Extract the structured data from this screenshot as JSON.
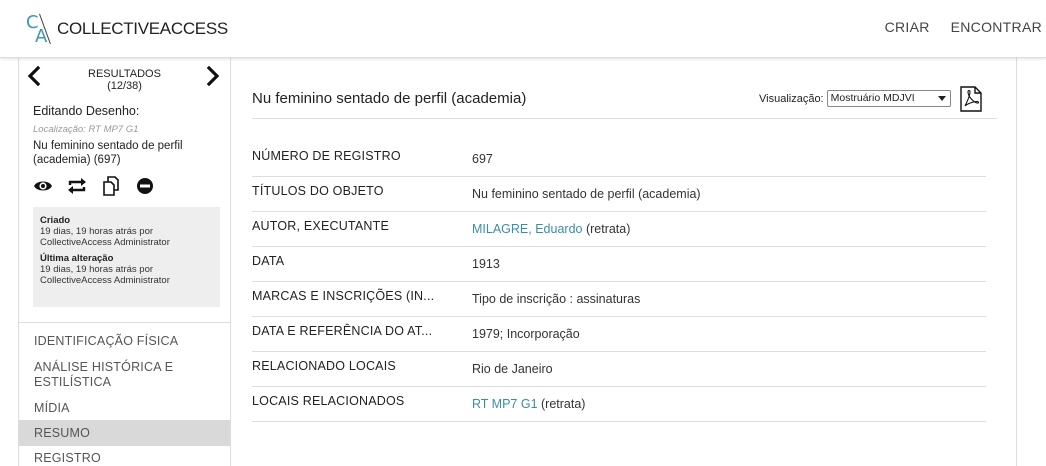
{
  "header": {
    "logo_c": "C",
    "logo_a": "A",
    "logo_text": "COLLECTIVEACCESS",
    "nav": [
      {
        "label": "CRIAR"
      },
      {
        "label": "ENCONTRAR"
      }
    ]
  },
  "sidebar": {
    "results_title": "RESULTADOS",
    "results_count": "(12/38)",
    "editing_title": "Editando Desenho:",
    "location": "Localização: RT MP7 G1",
    "record_name": "Nu feminino sentado de perfil (academia) (697)",
    "meta": {
      "created_label": "Criado",
      "created_value": "19 dias, 19 horas atrás por CollectiveAccess Administrator",
      "modified_label": "Última alteração",
      "modified_value": "19 dias, 19 horas atrás por CollectiveAccess Administrator"
    },
    "action_icons": [
      "eye-icon",
      "swap-icon",
      "duplicate-icon",
      "delete-icon"
    ],
    "nav_items": [
      {
        "label": "IDENTIFICAÇÃO FÍSICA"
      },
      {
        "label": "ANÁLISE HISTÓRICA E ESTILÍSTICA"
      },
      {
        "label": "MÍDIA"
      },
      {
        "label": "RESUMO",
        "active": true
      },
      {
        "label": "REGISTRO"
      }
    ]
  },
  "main": {
    "title": "Nu feminino sentado de perfil (academia)",
    "visualization_label": "Visualização:",
    "visualization_value": "Mostruário MDJVI",
    "rows": [
      {
        "label": "NÚMERO DE REGISTRO",
        "value": "697"
      },
      {
        "label": "TÍTULOS DO OBJETO",
        "value": "Nu feminino sentado de perfil (academia)"
      },
      {
        "label": "AUTOR, EXECUTANTE",
        "link": "MILAGRE, Eduardo",
        "suffix": " (retrata)"
      },
      {
        "label": "DATA",
        "value": "1913"
      },
      {
        "label": "MARCAS E INSCRIÇÕES (IN...",
        "value": "Tipo de inscrição : assinaturas"
      },
      {
        "label": "DATA E REFERÊNCIA DO AT...",
        "value": "1979; Incorporação"
      },
      {
        "label": "RELACIONADO LOCAIS",
        "value": "Rio de Janeiro"
      },
      {
        "label": "LOCAIS RELACIONADOS",
        "link": "RT MP7 G1",
        "suffix": " (retrata)"
      }
    ]
  },
  "colors": {
    "accent": "#3a8fa3",
    "active_nav_bg": "#d9d9d9",
    "meta_bg": "#eeeeee"
  }
}
